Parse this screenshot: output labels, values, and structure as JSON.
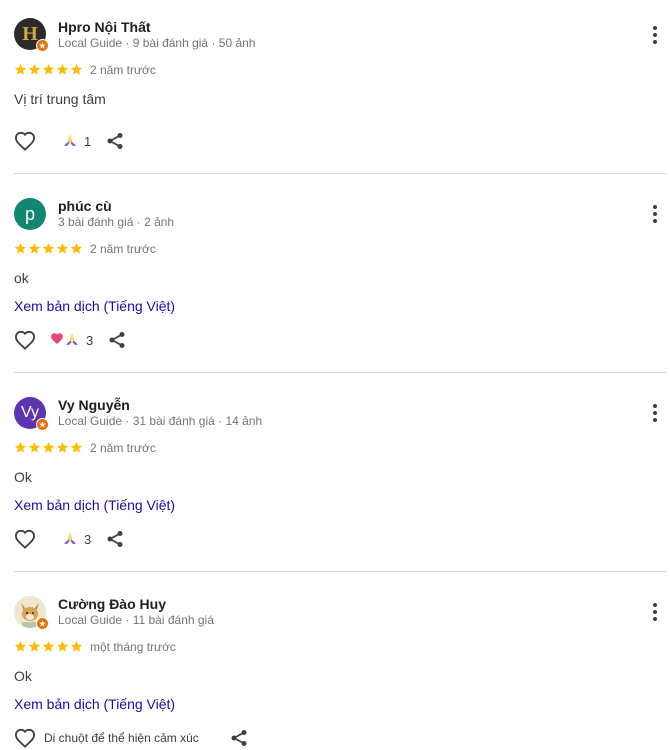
{
  "reviews": [
    {
      "name": "Hpro Nội Thất",
      "meta": "Local Guide · 9 bài đánh giá · 50 ảnh",
      "rating": 5,
      "time": "2 năm trước",
      "text": "Vị trí trung tâm",
      "reaction_count": "1",
      "avatar_letter": "H",
      "avatar_color": "#2b2b2b"
    },
    {
      "name": "phúc cù",
      "meta": "3 bài đánh giá · 2 ảnh",
      "rating": 5,
      "time": "2 năm trước",
      "text": "ok",
      "translate": "Xem bản dịch (Tiếng Việt)",
      "reaction_count": "3",
      "avatar_letter": "p",
      "avatar_color": "#12866f"
    },
    {
      "name": "Vy Nguyễn",
      "meta": "Local Guide · 31 bài đánh giá · 14 ảnh",
      "rating": 5,
      "time": "2 năm trước",
      "text": "Ok",
      "translate": "Xem bản dịch (Tiếng Việt)",
      "reaction_count": "3",
      "avatar_letter": "Vy",
      "avatar_color": "#5e35b1"
    },
    {
      "name": "Cường Đào Huy",
      "meta": "Local Guide · 11 bài đánh giá",
      "rating": 5,
      "time": "một tháng trước",
      "text": "Ok",
      "translate": "Xem bản dịch (Tiếng Việt)",
      "hint": "Di chuột để thể hiện cảm xúc",
      "avatar_color": "#e8dcc4"
    }
  ],
  "colors": {
    "star": "#fbbc04",
    "link": "#1a0dab",
    "badge": "#e8710a"
  }
}
